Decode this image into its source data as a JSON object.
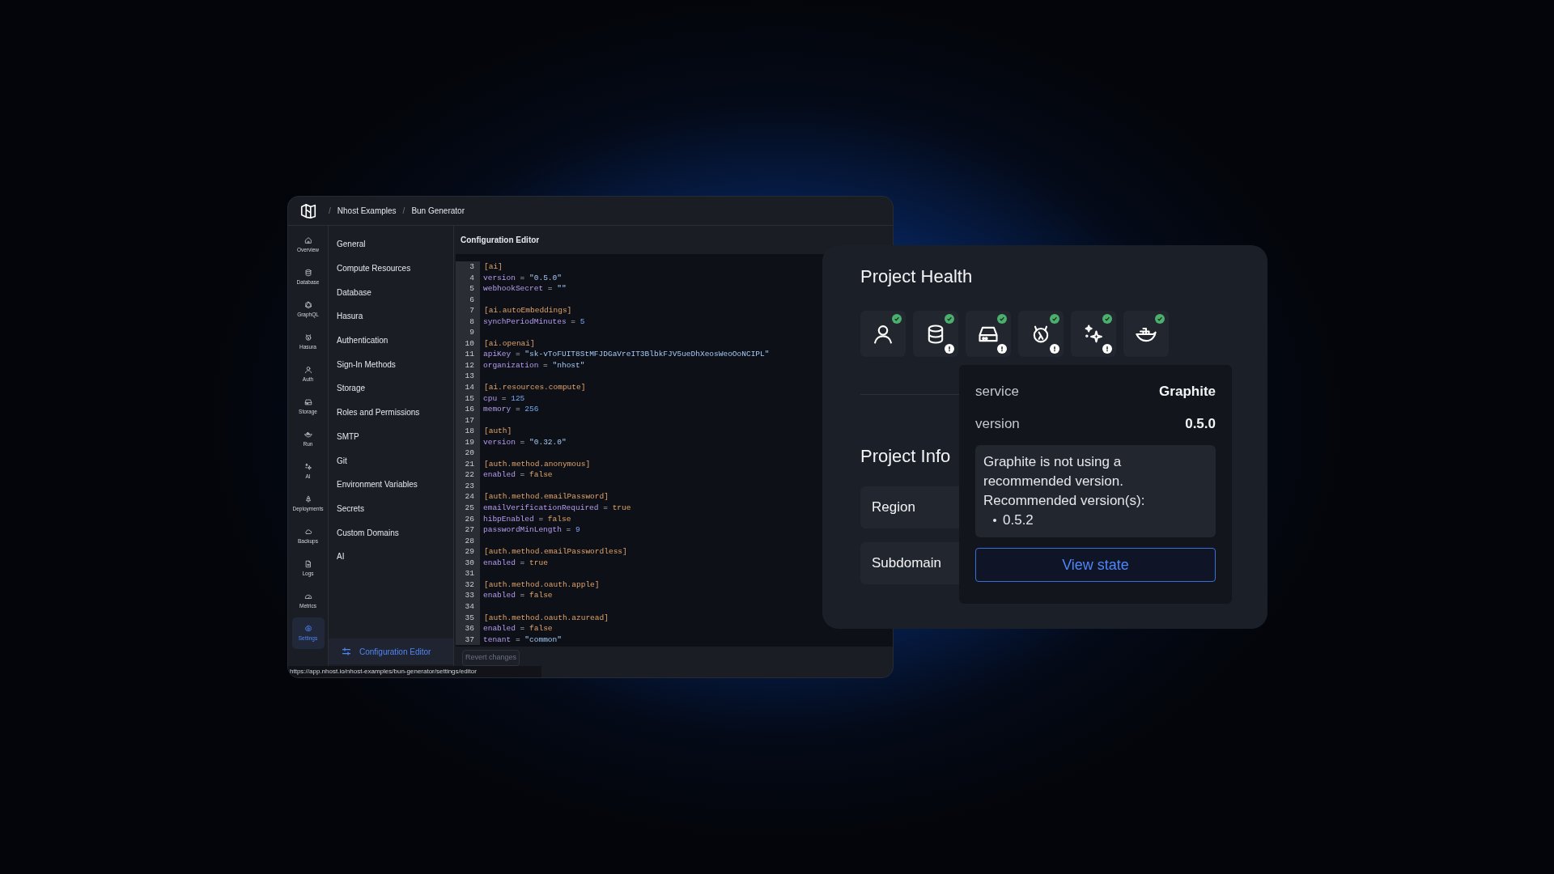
{
  "app_window": {
    "breadcrumb": [
      {
        "label": "/",
        "kind": "separator"
      },
      {
        "label": "Nhost Examples",
        "kind": "crumb"
      },
      {
        "label": "/",
        "kind": "separator"
      },
      {
        "label": "Bun Generator",
        "kind": "crumb"
      }
    ],
    "nav_rail": [
      {
        "label": "Overview",
        "selected": false
      },
      {
        "label": "Database",
        "selected": false
      },
      {
        "label": "GraphQL",
        "selected": false
      },
      {
        "label": "Hasura",
        "selected": false
      },
      {
        "label": "Auth",
        "selected": false
      },
      {
        "label": "Storage",
        "selected": false
      },
      {
        "label": "Run",
        "selected": false
      },
      {
        "label": "AI",
        "selected": false
      },
      {
        "label": "Deployments",
        "selected": false
      },
      {
        "label": "Backups",
        "selected": false
      },
      {
        "label": "Logs",
        "selected": false
      },
      {
        "label": "Metrics",
        "selected": false
      },
      {
        "label": "Settings",
        "selected": true
      }
    ],
    "settings_menu": [
      {
        "label": "General",
        "selected": false
      },
      {
        "label": "Compute Resources",
        "selected": false
      },
      {
        "label": "Database",
        "selected": false
      },
      {
        "label": "Hasura",
        "selected": false
      },
      {
        "label": "Authentication",
        "selected": false
      },
      {
        "label": "Sign-In Methods",
        "selected": false
      },
      {
        "label": "Storage",
        "selected": false
      },
      {
        "label": "Roles and Permissions",
        "selected": false
      },
      {
        "label": "SMTP",
        "selected": false
      },
      {
        "label": "Git",
        "selected": false
      },
      {
        "label": "Environment Variables",
        "selected": false
      },
      {
        "label": "Secrets",
        "selected": false
      },
      {
        "label": "Custom Domains",
        "selected": false
      },
      {
        "label": "AI",
        "selected": false
      }
    ],
    "bottom_menu_item": {
      "label": "Configuration Editor",
      "selected": true
    },
    "editor": {
      "title": "Configuration Editor",
      "lines": [
        {
          "n": "3",
          "kind": "section",
          "text": "[ai]"
        },
        {
          "n": "4",
          "kind": "string",
          "key": "version",
          "op": "=",
          "value": "\"0.5.0\""
        },
        {
          "n": "5",
          "kind": "string",
          "key": "webhookSecret",
          "op": "=",
          "value": "\"\""
        },
        {
          "n": "6",
          "kind": "blank"
        },
        {
          "n": "7",
          "kind": "section",
          "text": "[ai.autoEmbeddings]"
        },
        {
          "n": "8",
          "kind": "number",
          "key": "synchPeriodMinutes",
          "op": "=",
          "value": "5"
        },
        {
          "n": "9",
          "kind": "blank"
        },
        {
          "n": "10",
          "kind": "section",
          "text": "[ai.openai]"
        },
        {
          "n": "11",
          "kind": "string",
          "key": "apiKey",
          "op": "=",
          "value": "\"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\""
        },
        {
          "n": "12",
          "kind": "string",
          "key": "organization",
          "op": "=",
          "value": "\"nhost\""
        },
        {
          "n": "13",
          "kind": "blank"
        },
        {
          "n": "14",
          "kind": "section",
          "text": "[ai.resources.compute]"
        },
        {
          "n": "15",
          "kind": "number",
          "key": "cpu",
          "op": "=",
          "value": "125"
        },
        {
          "n": "16",
          "kind": "number",
          "key": "memory",
          "op": "=",
          "value": "256"
        },
        {
          "n": "17",
          "kind": "blank"
        },
        {
          "n": "18",
          "kind": "section",
          "text": "[auth]"
        },
        {
          "n": "19",
          "kind": "string",
          "key": "version",
          "op": "=",
          "value": "\"0.32.0\""
        },
        {
          "n": "20",
          "kind": "blank"
        },
        {
          "n": "21",
          "kind": "section",
          "text": "[auth.method.anonymous]"
        },
        {
          "n": "22",
          "kind": "boolean",
          "key": "enabled",
          "op": "=",
          "value": "false"
        },
        {
          "n": "23",
          "kind": "blank"
        },
        {
          "n": "24",
          "kind": "section",
          "text": "[auth.method.emailPassword]"
        },
        {
          "n": "25",
          "kind": "boolean",
          "key": "emailVerificationRequired",
          "op": "=",
          "value": "true"
        },
        {
          "n": "26",
          "kind": "boolean",
          "key": "hibpEnabled",
          "op": "=",
          "value": "false"
        },
        {
          "n": "27",
          "kind": "number",
          "key": "passwordMinLength",
          "op": "=",
          "value": "9"
        },
        {
          "n": "28",
          "kind": "blank"
        },
        {
          "n": "29",
          "kind": "section",
          "text": "[auth.method.emailPasswordless]"
        },
        {
          "n": "30",
          "kind": "boolean",
          "key": "enabled",
          "op": "=",
          "value": "true"
        },
        {
          "n": "31",
          "kind": "blank"
        },
        {
          "n": "32",
          "kind": "section",
          "text": "[auth.method.oauth.apple]"
        },
        {
          "n": "33",
          "kind": "boolean",
          "key": "enabled",
          "op": "=",
          "value": "false"
        },
        {
          "n": "34",
          "kind": "blank"
        },
        {
          "n": "35",
          "kind": "section",
          "text": "[auth.method.oauth.azuread]"
        },
        {
          "n": "36",
          "kind": "boolean",
          "key": "enabled",
          "op": "=",
          "value": "false"
        },
        {
          "n": "37",
          "kind": "string",
          "key": "tenant",
          "op": "=",
          "value": "\"common\""
        }
      ],
      "revert_button": {
        "label": "Revert changes",
        "disabled": true
      }
    },
    "status_url": "https://app.nhost.io/nhost-examples/bun-generator/settings/editor"
  },
  "project_health": {
    "title": "Project Health",
    "services": [
      {
        "healthy": true,
        "warning": false
      },
      {
        "healthy": true,
        "warning": true
      },
      {
        "healthy": true,
        "warning": true
      },
      {
        "healthy": true,
        "warning": true
      },
      {
        "healthy": true,
        "warning": true
      },
      {
        "healthy": true,
        "warning": false
      }
    ],
    "info_title": "Project Info",
    "info_rows": [
      {
        "label": "Region"
      },
      {
        "label": "Subdomain"
      }
    ],
    "popover": {
      "rows": [
        {
          "label": "service",
          "value": "Graphite"
        },
        {
          "label": "version",
          "value": "0.5.0"
        }
      ],
      "message": "Graphite is not using a recommended version.",
      "recommended_label": "Recommended version(s):",
      "recommended": [
        "0.5.2"
      ],
      "button": "View state"
    }
  }
}
